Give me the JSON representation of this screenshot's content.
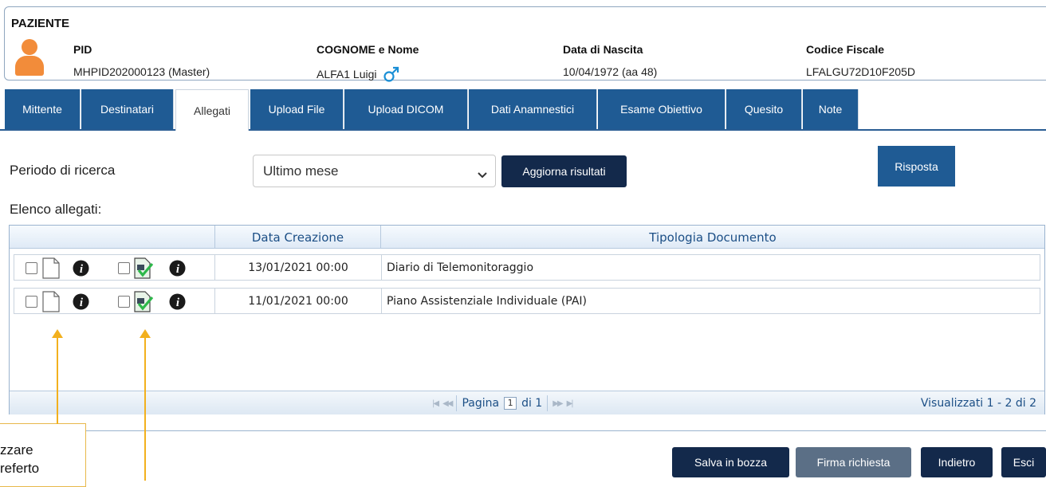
{
  "patient": {
    "title": "PAZIENTE",
    "pid_label": "PID",
    "pid_value": "MHPID202000123 (Master)",
    "name_label": "COGNOME e Nome",
    "name_value": "ALFA1 Luigi",
    "dob_label": "Data di Nascita",
    "dob_value": "10/04/1972 (aa 48)",
    "cf_label": "Codice Fiscale",
    "cf_value": "LFALGU72D10F205D",
    "gender_icon": "male-symbol",
    "avatar_color": "#f28c3a"
  },
  "tabs": [
    {
      "label": "Mittente",
      "active": false
    },
    {
      "label": "Destinatari",
      "active": false
    },
    {
      "label": "Allegati",
      "active": true
    },
    {
      "label": "Upload File",
      "active": false
    },
    {
      "label": "Upload DICOM",
      "active": false
    },
    {
      "label": "Dati Anamnestici",
      "active": false
    },
    {
      "label": "Esame Obiettivo",
      "active": false
    },
    {
      "label": "Quesito",
      "active": false
    },
    {
      "label": "Note",
      "active": false
    }
  ],
  "search": {
    "period_label": "Periodo di ricerca",
    "period_value": "Ultimo mese",
    "refresh_label": "Aggiorna risultati",
    "reply_label": "Risposta"
  },
  "attachments": {
    "list_label": "Elenco allegati:",
    "columns": [
      "Data Creazione",
      "Tipologia Documento"
    ],
    "rows": [
      {
        "date": "13/01/2021 00:00",
        "type": "Diario di Telemonitoraggio"
      },
      {
        "date": "11/01/2021 00:00",
        "type": "Piano Assistenziale Individuale (PAI)"
      }
    ],
    "pager": {
      "page_label": "Pagina",
      "page_value": "1",
      "of_label": "di 1"
    },
    "visible_label": "Visualizzati 1 - 2 di 2"
  },
  "actions": {
    "save_draft": "Salva in bozza",
    "sign_request": "Firma richiesta",
    "back": "Indietro",
    "exit": "Esci"
  },
  "annotation": {
    "line1": "zzare",
    "line2": "referto"
  },
  "colors": {
    "primary": "#1f5b94",
    "dark": "#13294b",
    "annotation": "#f2b01e"
  }
}
